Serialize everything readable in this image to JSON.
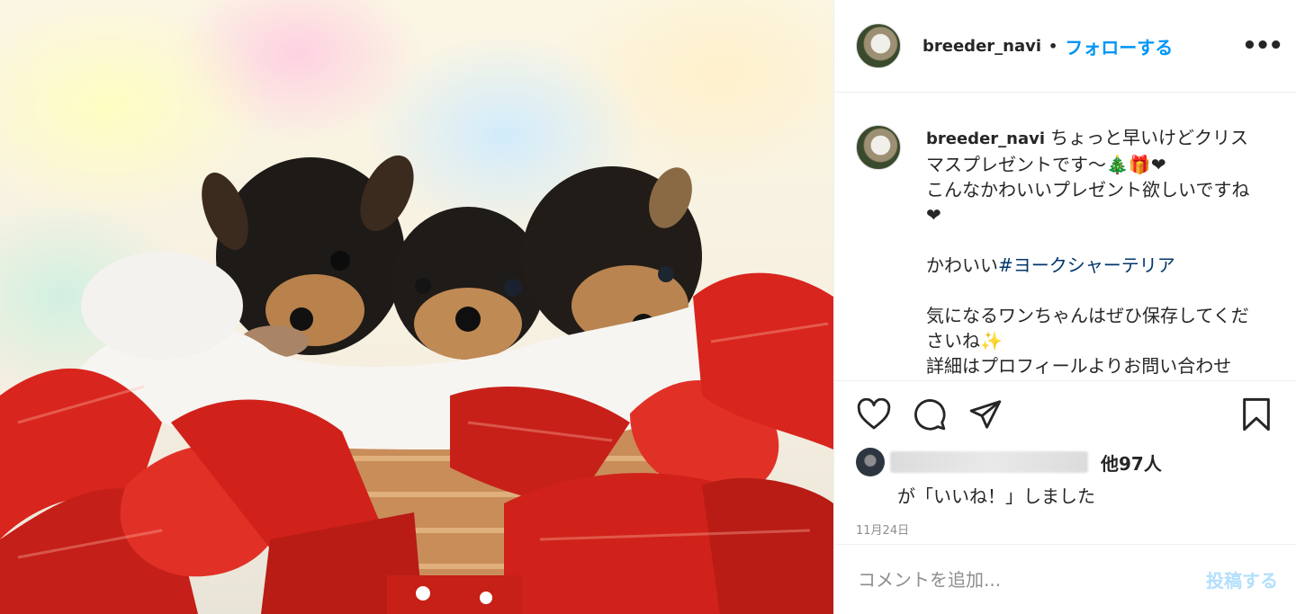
{
  "header": {
    "username": "breeder_navi",
    "separator": "•",
    "follow_label": "フォローする",
    "more_label": "•••"
  },
  "caption": {
    "username": "breeder_navi",
    "line1": "ちょっと早いけどクリスマスプレゼントです～",
    "emoji_tree": "🎄",
    "emoji_gift": "🎁",
    "emoji_heart": "❤",
    "line2": "こんなかわいいプレゼント欲しいですね",
    "line3_prefix": "かわいい",
    "hashtag": "#ヨークシャーテリア",
    "line4": "気になるワンちゃんはぜひ保存してくださいね",
    "emoji_spark": "✨",
    "line5": "詳細はプロフィールよりお問い合わせ"
  },
  "likes": {
    "count_text": "他97人",
    "suffix": "が「いいね！」しました"
  },
  "date": "11月24日",
  "comment": {
    "placeholder": "コメントを追加...",
    "post_label": "投稿する"
  },
  "icons": {
    "like": "heart-icon",
    "comment": "speech-bubble-icon",
    "share": "paper-plane-icon",
    "save": "bookmark-icon"
  },
  "colors": {
    "accent": "#0095f6",
    "post_disabled": "#b2dffc",
    "hashtag": "#00376b",
    "secondary_text": "#8e8e8e",
    "border": "#efefef"
  }
}
